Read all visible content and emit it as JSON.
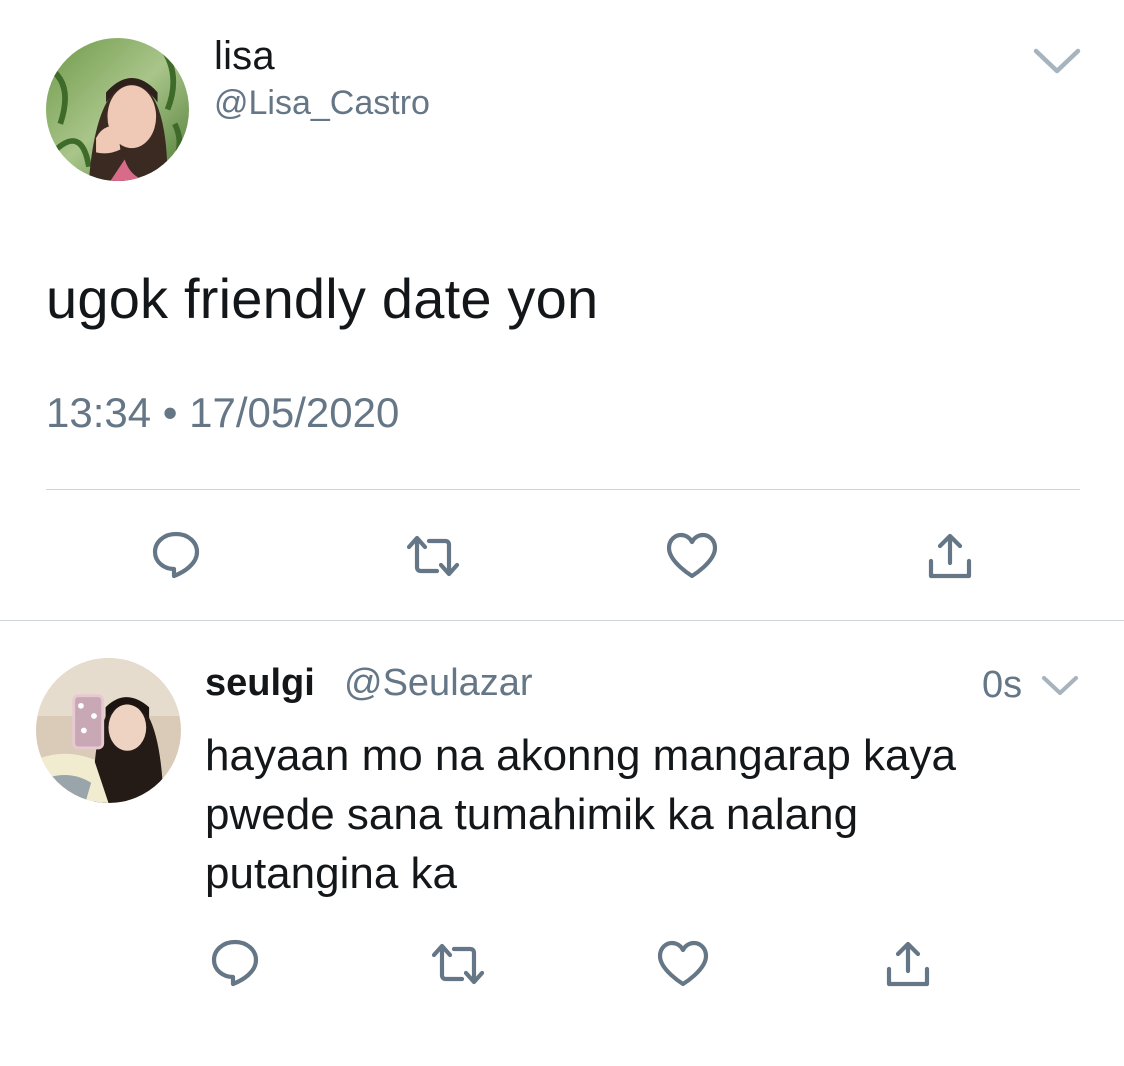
{
  "main_tweet": {
    "display_name": "lisa",
    "handle": "@Lisa_Castro",
    "text": "ugok friendly date yon",
    "timestamp": "13:34 • 17/05/2020",
    "avatar_icon": "profile-photo",
    "menu_icon": "chevron-down-icon",
    "actions": [
      "reply-icon",
      "retweet-icon",
      "like-icon",
      "share-icon"
    ]
  },
  "reply_tweet": {
    "display_name": "seulgi",
    "handle": "@Seulazar",
    "time": "0s",
    "text_lines": [
      "hayaan mo na akonng mangarap kaya",
      "pwede sana tumahimik ka nalang",
      "putangina ka"
    ],
    "avatar_icon": "profile-photo",
    "menu_icon": "chevron-down-icon",
    "actions": [
      "reply-icon",
      "retweet-icon",
      "like-icon",
      "share-icon"
    ]
  },
  "colors": {
    "text_primary": "#14171a",
    "text_secondary": "#657786",
    "icon": "#657786",
    "divider": "#ccd6dd",
    "background": "#ffffff"
  }
}
